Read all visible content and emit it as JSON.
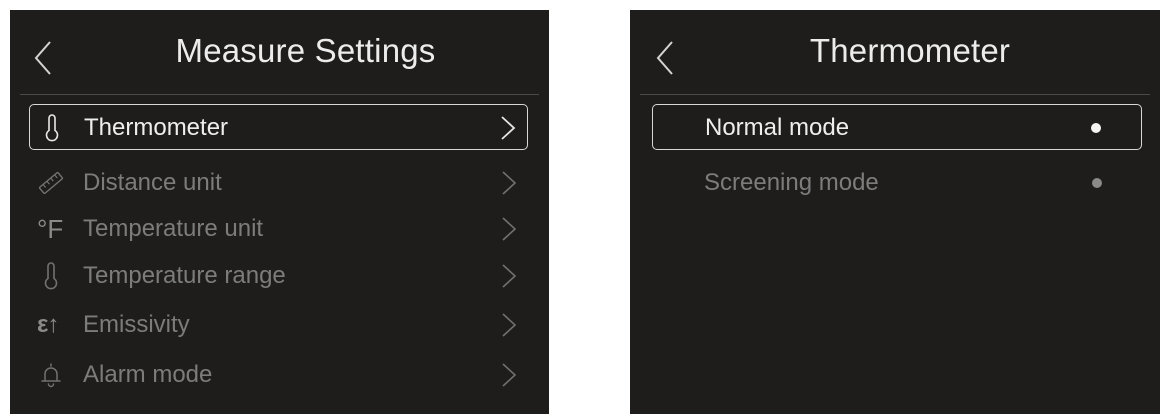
{
  "left_panel": {
    "title": "Measure Settings",
    "back_icon": "chevron-left-icon",
    "items": [
      {
        "label": "Thermometer",
        "icon": "thermometer-icon",
        "selected": true
      },
      {
        "label": "Distance unit",
        "icon": "ruler-icon",
        "selected": false
      },
      {
        "label": "Temperature unit",
        "icon": "fahrenheit-unit-icon",
        "icon_text": "°F",
        "selected": false
      },
      {
        "label": "Temperature range",
        "icon": "thermometer-icon",
        "selected": false
      },
      {
        "label": "Emissivity",
        "icon": "emissivity-icon",
        "icon_text": "ε↑",
        "selected": false
      },
      {
        "label": "Alarm mode",
        "icon": "bell-icon",
        "selected": false
      }
    ]
  },
  "right_panel": {
    "title": "Thermometer",
    "back_icon": "chevron-left-icon",
    "options": [
      {
        "label": "Normal mode",
        "selected": true
      },
      {
        "label": "Screening mode",
        "selected": false
      }
    ]
  },
  "colors": {
    "panel_background": "#1e1d1b",
    "text_active": "#eeeeee",
    "text_inactive": "#7c7c7c",
    "selection_border": "#d8d8d8"
  }
}
